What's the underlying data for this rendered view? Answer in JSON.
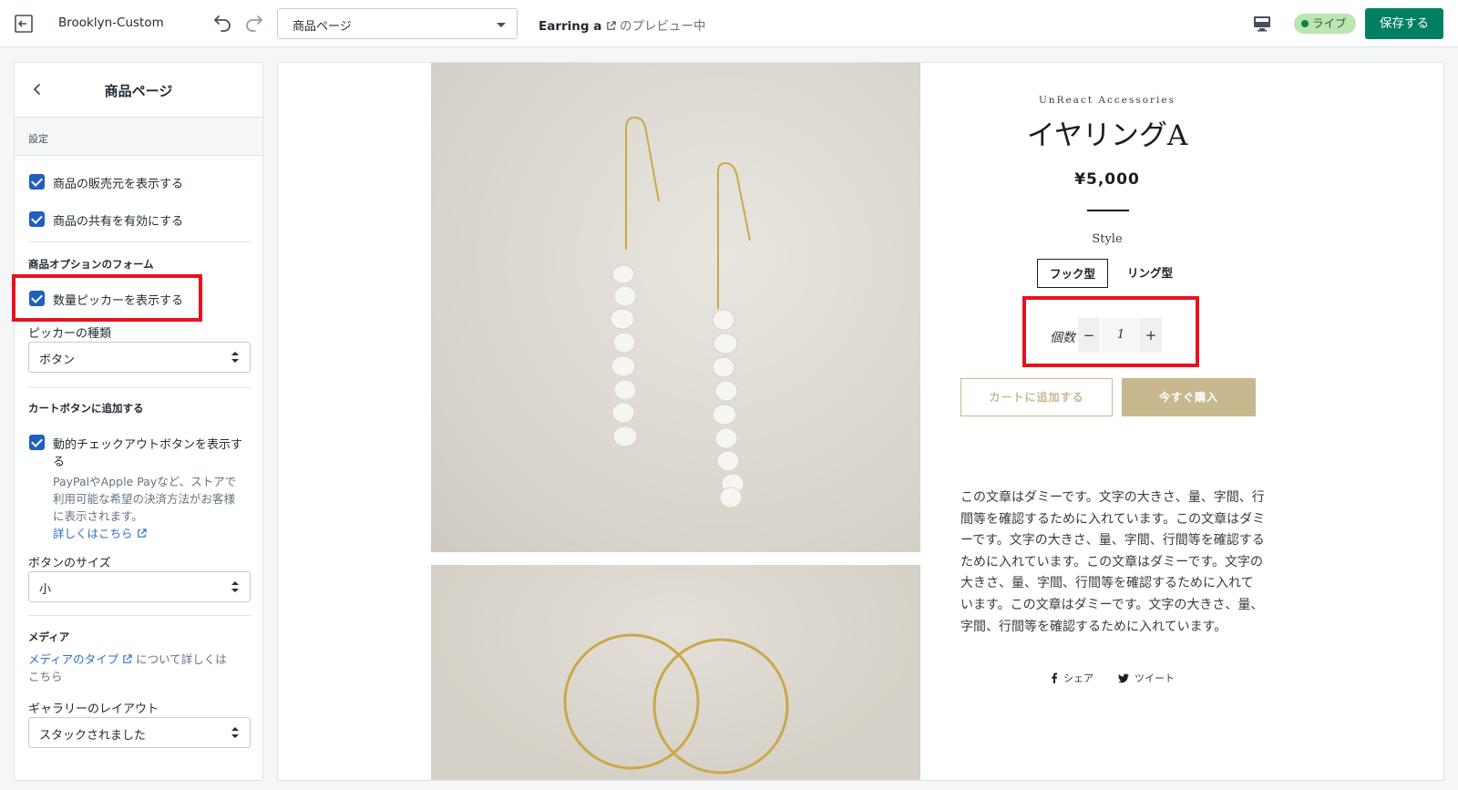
{
  "topbar": {
    "theme_name": "Brooklyn-Custom",
    "page_select_value": "商品ページ",
    "preview_product": "Earring a",
    "preview_suffix": "のプレビュー中",
    "live_label": "ライブ",
    "save_label": "保存する",
    "colors": {
      "save": "#008060",
      "live_bg": "#bbe5b3",
      "live_dot": "#108043"
    }
  },
  "sidebar": {
    "title": "商品ページ",
    "section_label": "設定",
    "checkbox_show_vendor": "商品の販売元を表示する",
    "checkbox_enable_share": "商品の共有を有効にする",
    "form_heading": "商品オプションのフォーム",
    "checkbox_show_qty": "数量ピッカーを表示する",
    "picker_type_label": "ピッカーの種類",
    "picker_type_value": "ボタン",
    "cart_heading": "カートボタンに追加する",
    "checkbox_dynamic_line1": "動的チェックアウトボタンを表示す",
    "checkbox_dynamic_line2": "る",
    "help_line1": "PayPalやApple Payなど、ストアで",
    "help_line2": "利用可能な希望の決済方法がお客様",
    "help_line3": "に表示されます。",
    "help_link": "詳しくはこちら",
    "button_size_label": "ボタンのサイズ",
    "button_size_value": "小",
    "media_heading": "メディア",
    "media_link": "メディアのタイプ",
    "media_text1": "について詳しくは",
    "media_text2": "こちら",
    "gallery_label": "ギャラリーのレイアウト",
    "gallery_value": "スタックされました",
    "colors": {
      "checkbox": "#1f5fbf",
      "highlight": "#e7121e",
      "link": "#2c6ecb"
    }
  },
  "product": {
    "vendor": "UnReact Accessories",
    "title": "イヤリングA",
    "price": "¥5,000",
    "option_name": "Style",
    "options": [
      "フック型",
      "リング型"
    ],
    "selected_option": "フック型",
    "quantity_label": "個数",
    "quantity_value": "1",
    "minus": "−",
    "plus": "+",
    "add_to_cart": "カートに追加する",
    "buy_now": "今すぐ購入",
    "description": "この文章はダミーです。文字の大きさ、量、字間、行間等を確認するために入れています。この文章はダミーです。文字の大きさ、量、字間、行間等を確認するために入れています。この文章はダミーです。文字の大きさ、量、字間、行間等を確認するために入れています。この文章はダミーです。文字の大きさ、量、字間、行間等を確認するために入れています。",
    "share_label": "シェア",
    "tweet_label": "ツイート",
    "colors": {
      "accent": "#c8b88f"
    }
  },
  "icons": [
    "exit-icon",
    "undo-icon",
    "redo-icon",
    "chevron-down-icon",
    "external-link-icon",
    "monitor-icon",
    "back-chevron-icon",
    "checkmark-icon",
    "select-arrows-icon",
    "facebook-icon",
    "twitter-icon"
  ]
}
